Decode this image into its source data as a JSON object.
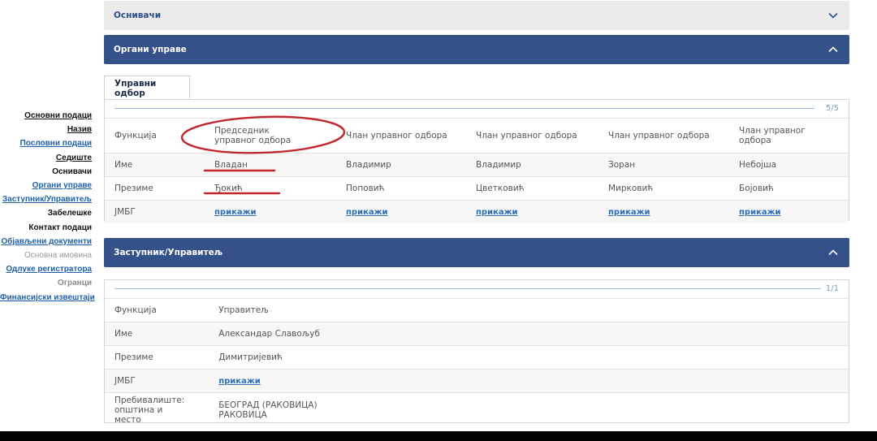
{
  "sidebar": {
    "items": [
      {
        "label": "Основни подаци",
        "style": "plain"
      },
      {
        "label": "Назив",
        "style": "plain"
      },
      {
        "label": "Пословни подаци",
        "style": "link"
      },
      {
        "label": "Седиште",
        "style": "plain"
      },
      {
        "label": "Оснивачи",
        "style": "black"
      },
      {
        "label": "Органи управе",
        "style": "link"
      },
      {
        "label": "Заступник/Управитељ",
        "style": "link"
      },
      {
        "label": "Забелешке",
        "style": "black"
      },
      {
        "label": "Контакт подаци",
        "style": "black"
      },
      {
        "label": "Објављени документи",
        "style": "link"
      },
      {
        "label": "Основна имовина",
        "style": "muted"
      },
      {
        "label": "Одлуке регистратора",
        "style": "link"
      },
      {
        "label": "Огранци",
        "style": "muted2"
      },
      {
        "label": "Финансијски извештаји",
        "style": "link"
      }
    ]
  },
  "sections": {
    "founders": {
      "title": "Оснивачи"
    },
    "governance": {
      "title": "Органи управе"
    },
    "representative": {
      "title": "Заступник/Управитељ"
    }
  },
  "governance": {
    "tab": "Управни одбор",
    "counter": "5/5",
    "labels": {
      "function": "Функција",
      "name": "Име",
      "surname": "Презиме",
      "jmbg": "ЈМБГ"
    },
    "members": [
      {
        "function": "Председник управног одбора",
        "name": "Владан",
        "surname": "Ђокић",
        "jmbg": "прикажи"
      },
      {
        "function": "Члан управног одбора",
        "name": "Владимир",
        "surname": "Поповић",
        "jmbg": "прикажи"
      },
      {
        "function": "Члан управног одбора",
        "name": "Владимир",
        "surname": "Цветковић",
        "jmbg": "прикажи"
      },
      {
        "function": "Члан управног одбора",
        "name": "Зоран",
        "surname": "Мирковић",
        "jmbg": "прикажи"
      },
      {
        "function": "Члан управног одбора",
        "name": "Небојша",
        "surname": "Бојовић",
        "jmbg": "прикажи"
      }
    ]
  },
  "representative": {
    "counter": "1/1",
    "rows": [
      {
        "label": "Функција",
        "value": "Управитељ"
      },
      {
        "label": "Име",
        "value": "Александар Славољуб"
      },
      {
        "label": "Презиме",
        "value": "Димитријевић"
      },
      {
        "label": "ЈМБГ",
        "value": "прикажи"
      },
      {
        "label": "Пребивалиште: општина и место",
        "value": "БЕОГРАД (РАКОВИЦА) РАКОВИЦА"
      }
    ]
  },
  "colors": {
    "header_dark": "#355189",
    "header_light": "#ebebeb",
    "link": "#1f5fa8",
    "annotation": "#c0282d"
  }
}
